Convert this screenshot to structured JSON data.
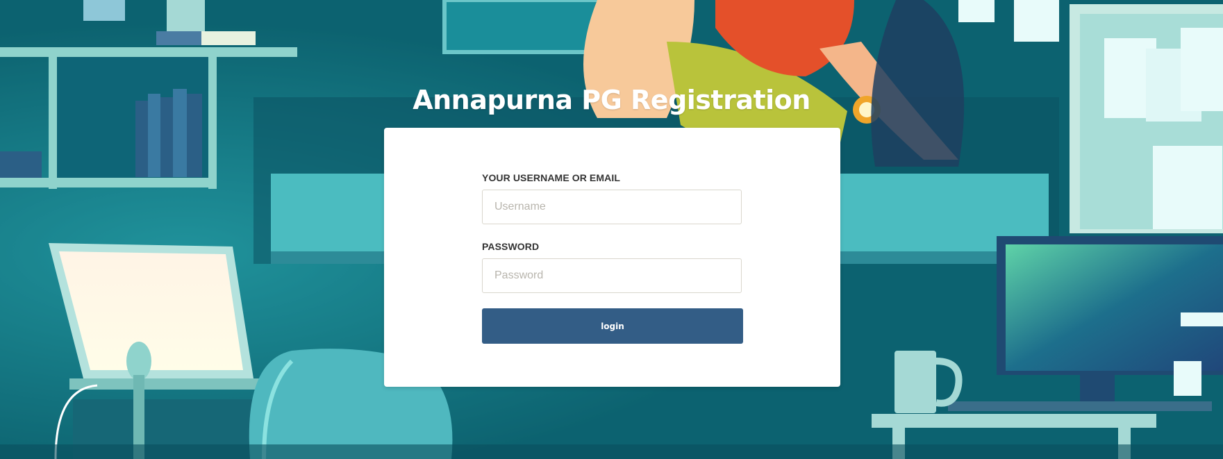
{
  "page": {
    "title": "Annapurna PG Registration"
  },
  "form": {
    "username_label": "YOUR USERNAME OR EMAIL",
    "username_placeholder": "Username",
    "username_value": "",
    "password_label": "PASSWORD",
    "password_placeholder": "Password",
    "password_value": "",
    "login_label": "login"
  },
  "colors": {
    "button_bg": "#335d86",
    "background_teal": "#0f6b78",
    "card_bg": "#ffffff"
  }
}
